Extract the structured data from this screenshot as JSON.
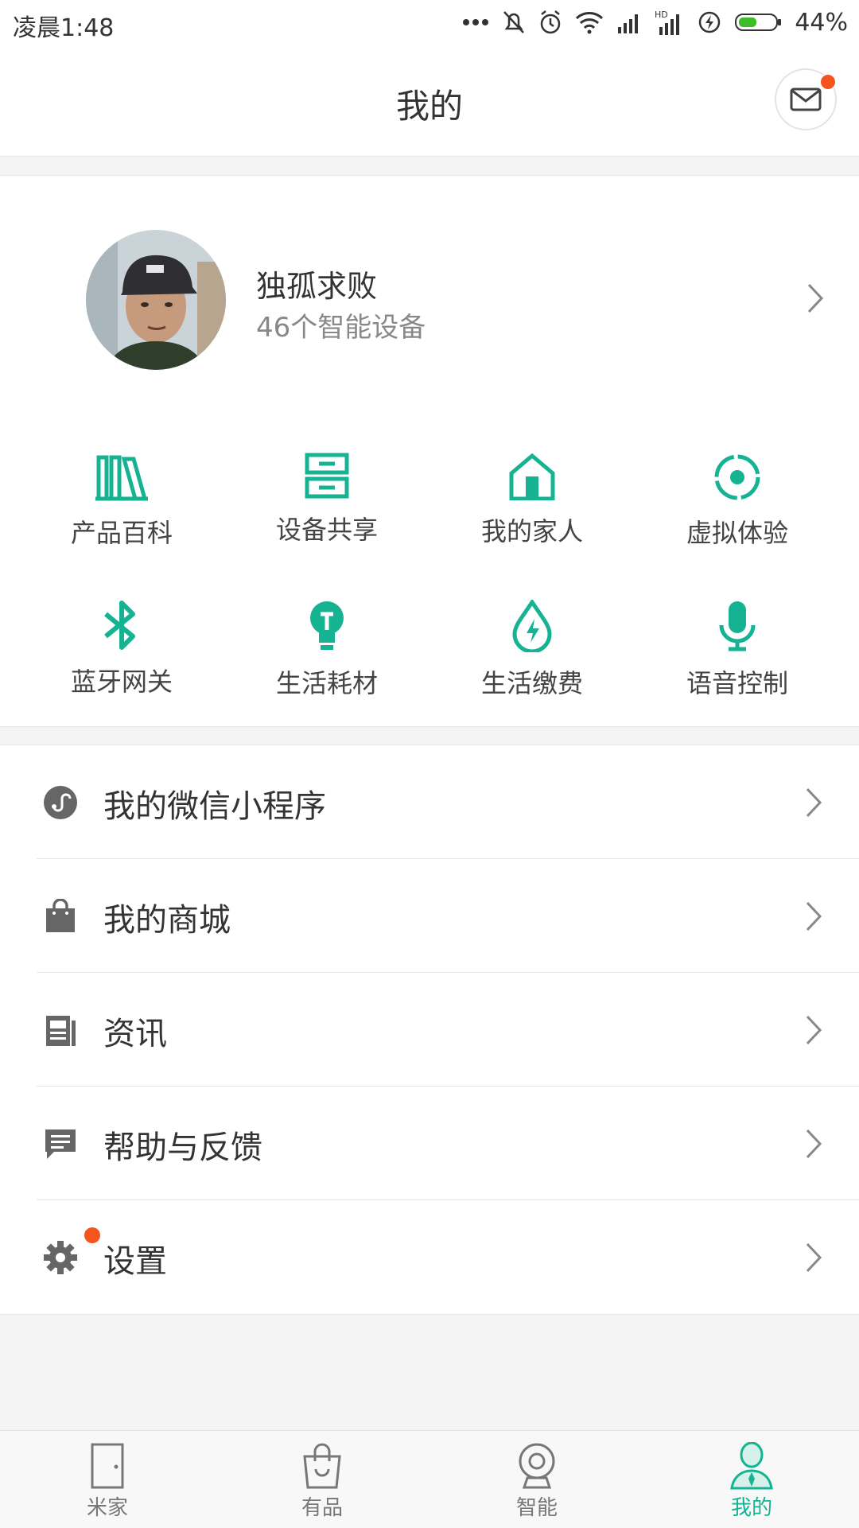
{
  "status_bar": {
    "time": "凌晨1:48",
    "battery_percent": "44%",
    "network_label": "HD",
    "icons": [
      "more-dots-icon",
      "mute-icon",
      "alarm-icon",
      "wifi-icon",
      "signal-icon",
      "hd-signal-icon",
      "charging-icon",
      "battery-icon"
    ]
  },
  "header": {
    "title": "我的",
    "message_icon": "mail-icon",
    "has_notification": true
  },
  "profile": {
    "name": "独孤求败",
    "device_count": "46个智能设备"
  },
  "grid": {
    "items": [
      {
        "label": "产品百科",
        "icon": "books-icon"
      },
      {
        "label": "设备共享",
        "icon": "drawers-icon"
      },
      {
        "label": "我的家人",
        "icon": "house-icon"
      },
      {
        "label": "虚拟体验",
        "icon": "target-icon"
      },
      {
        "label": "蓝牙网关",
        "icon": "bluetooth-icon"
      },
      {
        "label": "生活耗材",
        "icon": "bulb-icon"
      },
      {
        "label": "生活缴费",
        "icon": "drop-bolt-icon"
      },
      {
        "label": "语音控制",
        "icon": "mic-icon"
      }
    ]
  },
  "menu": {
    "items": [
      {
        "label": "我的微信小程序",
        "icon": "mini-program-icon"
      },
      {
        "label": "我的商城",
        "icon": "shopping-bag-icon"
      },
      {
        "label": "资讯",
        "icon": "news-icon"
      },
      {
        "label": "帮助与反馈",
        "icon": "feedback-icon"
      },
      {
        "label": "设置",
        "icon": "settings-gear-icon",
        "badge": true
      }
    ]
  },
  "bottom_nav": {
    "tabs": [
      {
        "label": "米家",
        "icon": "door-icon",
        "active": false
      },
      {
        "label": "有品",
        "icon": "bag-icon",
        "active": false
      },
      {
        "label": "智能",
        "icon": "camera-icon",
        "active": false
      },
      {
        "label": "我的",
        "icon": "person-icon",
        "active": true
      }
    ]
  },
  "colors": {
    "accent": "#16b393",
    "badge": "#f5541e",
    "background": "#f4f4f4"
  }
}
